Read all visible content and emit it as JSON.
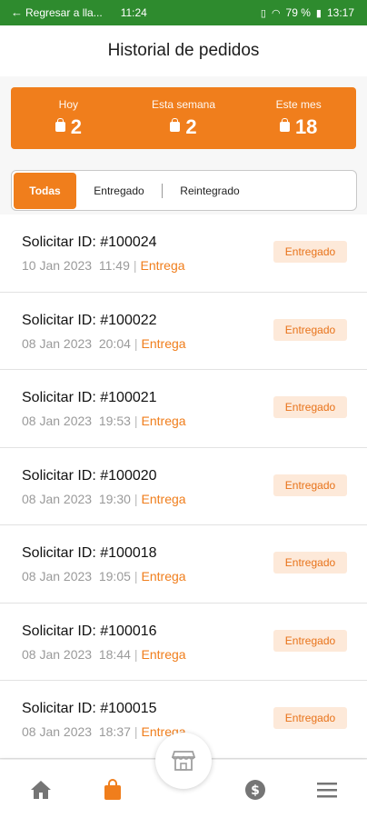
{
  "status_bar": {
    "back_label": "Regresar a lla...",
    "time_left": "11:24",
    "battery": "79 %",
    "time_right": "13:17"
  },
  "header": {
    "title": "Historial de pedidos"
  },
  "stats": [
    {
      "label": "Hoy",
      "value": "2"
    },
    {
      "label": "Esta semana",
      "value": "2"
    },
    {
      "label": "Este mes",
      "value": "18"
    }
  ],
  "tabs": [
    {
      "label": "Todas",
      "active": true
    },
    {
      "label": "Entregado",
      "active": false
    },
    {
      "label": "Reintegrado",
      "active": false
    }
  ],
  "orders": [
    {
      "id": "Solicitar ID: #100024",
      "date": "10 Jan 2023",
      "time": "11:49",
      "type": "Entrega",
      "status": "Entregado"
    },
    {
      "id": "Solicitar ID: #100022",
      "date": "08 Jan 2023",
      "time": "20:04",
      "type": "Entrega",
      "status": "Entregado"
    },
    {
      "id": "Solicitar ID: #100021",
      "date": "08 Jan 2023",
      "time": "19:53",
      "type": "Entrega",
      "status": "Entregado"
    },
    {
      "id": "Solicitar ID: #100020",
      "date": "08 Jan 2023",
      "time": "19:30",
      "type": "Entrega",
      "status": "Entregado"
    },
    {
      "id": "Solicitar ID: #100018",
      "date": "08 Jan 2023",
      "time": "19:05",
      "type": "Entrega",
      "status": "Entregado"
    },
    {
      "id": "Solicitar ID: #100016",
      "date": "08 Jan 2023",
      "time": "18:44",
      "type": "Entrega",
      "status": "Entregado"
    },
    {
      "id": "Solicitar ID: #100015",
      "date": "08 Jan 2023",
      "time": "18:37",
      "type": "Entrega",
      "status": "Entregado"
    }
  ],
  "bottom_nav": {
    "items": [
      "home-icon",
      "bag-icon",
      "store-icon",
      "dollar-icon",
      "menu-icon"
    ]
  },
  "colors": {
    "accent": "#f07e1c",
    "status_bar": "#2e8b2e",
    "badge_bg": "#fde9d9"
  }
}
